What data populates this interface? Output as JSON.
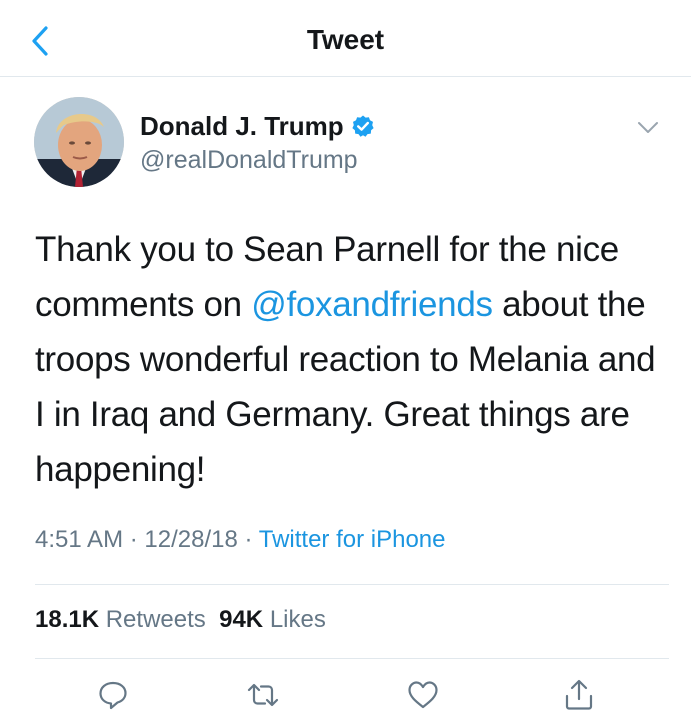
{
  "header": {
    "title": "Tweet"
  },
  "author": {
    "display_name": "Donald J. Trump",
    "handle": "@realDonaldTrump"
  },
  "tweet": {
    "text_before": "Thank you to Sean Parnell for the nice comments on ",
    "mention": "@foxandfriends",
    "text_after": " about the troops wonderful reaction to Melania and I in Iraq and Germany. Great things are happening!"
  },
  "meta": {
    "time": "4:51 AM",
    "date": "12/28/18",
    "separator": "·",
    "source": "Twitter for iPhone"
  },
  "stats": {
    "retweets_count": "18.1K",
    "retweets_label": "Retweets",
    "likes_count": "94K",
    "likes_label": "Likes"
  },
  "icons": {
    "back": "chevron-left-icon",
    "verified": "verified-badge-icon",
    "caret": "chevron-down-icon",
    "reply": "reply-icon",
    "retweet": "retweet-icon",
    "like": "heart-icon",
    "share": "share-icon"
  },
  "colors": {
    "accent": "#1da1f2",
    "link": "#1b95e0",
    "text": "#14171a",
    "secondary": "#657786"
  }
}
